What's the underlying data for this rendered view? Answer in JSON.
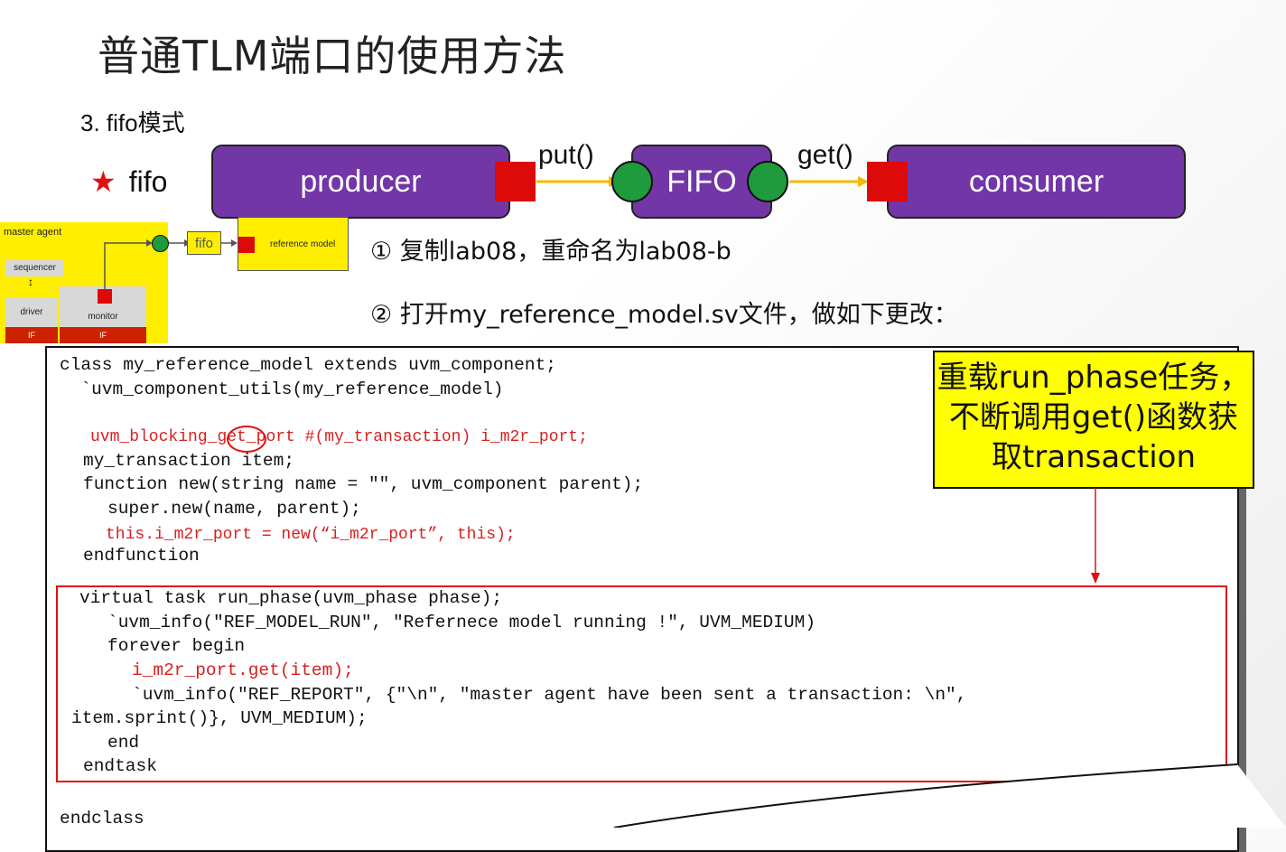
{
  "title": "普通TLM端口的使用方法",
  "subtitle": "3. fifo模式",
  "star_label": "fifo",
  "diagram": {
    "producer": "producer",
    "fifo": "FIFO",
    "consumer": "consumer",
    "put_label": "put()",
    "get_label": "get()"
  },
  "mini_diagram": {
    "master_agent": "master agent",
    "sequencer": "sequencer",
    "driver": "driver",
    "monitor": "monitor",
    "if_left": "IF",
    "if_right": "IF",
    "fifo": "fifo",
    "reference_model": "reference model"
  },
  "steps": {
    "step1": "① 复制lab08，重命名为lab08-b",
    "step2": "② 打开my_reference_model.sv文件，做如下更改："
  },
  "note": {
    "line1": "重载run_phase任务，",
    "line2": "不断调用get()函数获",
    "line3": "取transaction"
  },
  "code": {
    "l1": "class my_reference_model extends uvm_component;",
    "l2": "  `uvm_component_utils(my_reference_model)",
    "l3a": "uvm_blocking_",
    "l3b": "get",
    "l3c": "_port #(my_transaction) i_m2r_port;",
    "l4": "my_transaction item;",
    "l5": "function new(string name = \"\", uvm_component parent);",
    "l6": "super.new(name, parent);",
    "l7": "this.i_m2r_port = new(“i_m2r_port”, this);",
    "l8": "endfunction",
    "l9": "virtual task run_phase(uvm_phase phase);",
    "l10": "`uvm_info(\"REF_MODEL_RUN\", \"Refernece model running !\", UVM_MEDIUM)",
    "l11": "forever begin",
    "l12": "i_m2r_port.get(item);",
    "l13": "`uvm_info(\"REF_REPORT\", {\"\\n\", \"master agent have been sent a transaction: \\n\",",
    "l14": "item.sprint()}, UVM_MEDIUM);",
    "l15": "end",
    "l16": "endtask",
    "l17": "endclass"
  },
  "colors": {
    "block": "#7236a6",
    "port_square": "#dd0a0a",
    "port_circle": "#1f9a3c",
    "arrow": "#f5b800",
    "highlight": "#ffff00"
  }
}
